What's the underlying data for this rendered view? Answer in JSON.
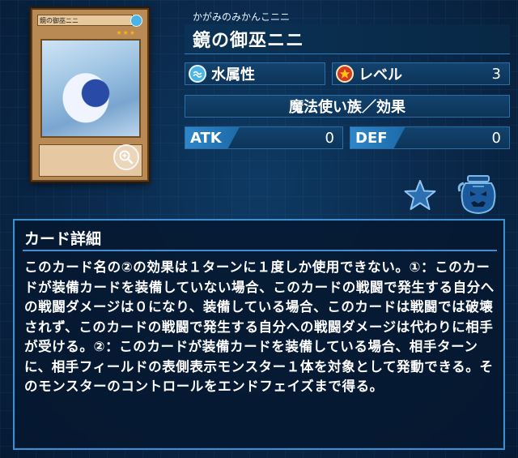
{
  "card": {
    "thumb_name": "鏡の御巫ニニ",
    "thumb_stars": "★★★"
  },
  "name": {
    "reading": "かがみのみかんこニニ",
    "title": "鏡の御巫ニニ"
  },
  "stats": {
    "attribute_label": "水属性",
    "attribute_icon": "water-attribute-icon",
    "level_label": "レベル",
    "level_value": "3",
    "type_label": "魔法使い族／効果",
    "atk_label": "ATK",
    "atk_value": "0",
    "def_label": "DEF",
    "def_value": "0"
  },
  "actions": {
    "favorite_icon": "star-icon",
    "jar_icon": "jar-icon",
    "zoom_icon": "magnifier-icon"
  },
  "details": {
    "title": "カード詳細",
    "text": "このカード名の②の効果は１ターンに１度しか使用できない。①：このカードが装備カードを装備していない場合、このカードの戦闘で発生する自分への戦闘ダメージは０になり、装備している場合、このカードは戦闘では破壊されず、このカードの戦闘で発生する自分への戦闘ダメージは代わりに相手が受ける。②：このカードが装備カードを装備している場合、相手ターンに、相手フィールドの表側表示モンスター１体を対象として発動できる。そのモンスターのコントロールをエンドフェイズまで得る。"
  },
  "colors": {
    "background": "#0a2748",
    "accent": "#3f8fd0",
    "water": "#4bb4e6",
    "level": "#d43a1c",
    "star": "#ffb01e"
  }
}
